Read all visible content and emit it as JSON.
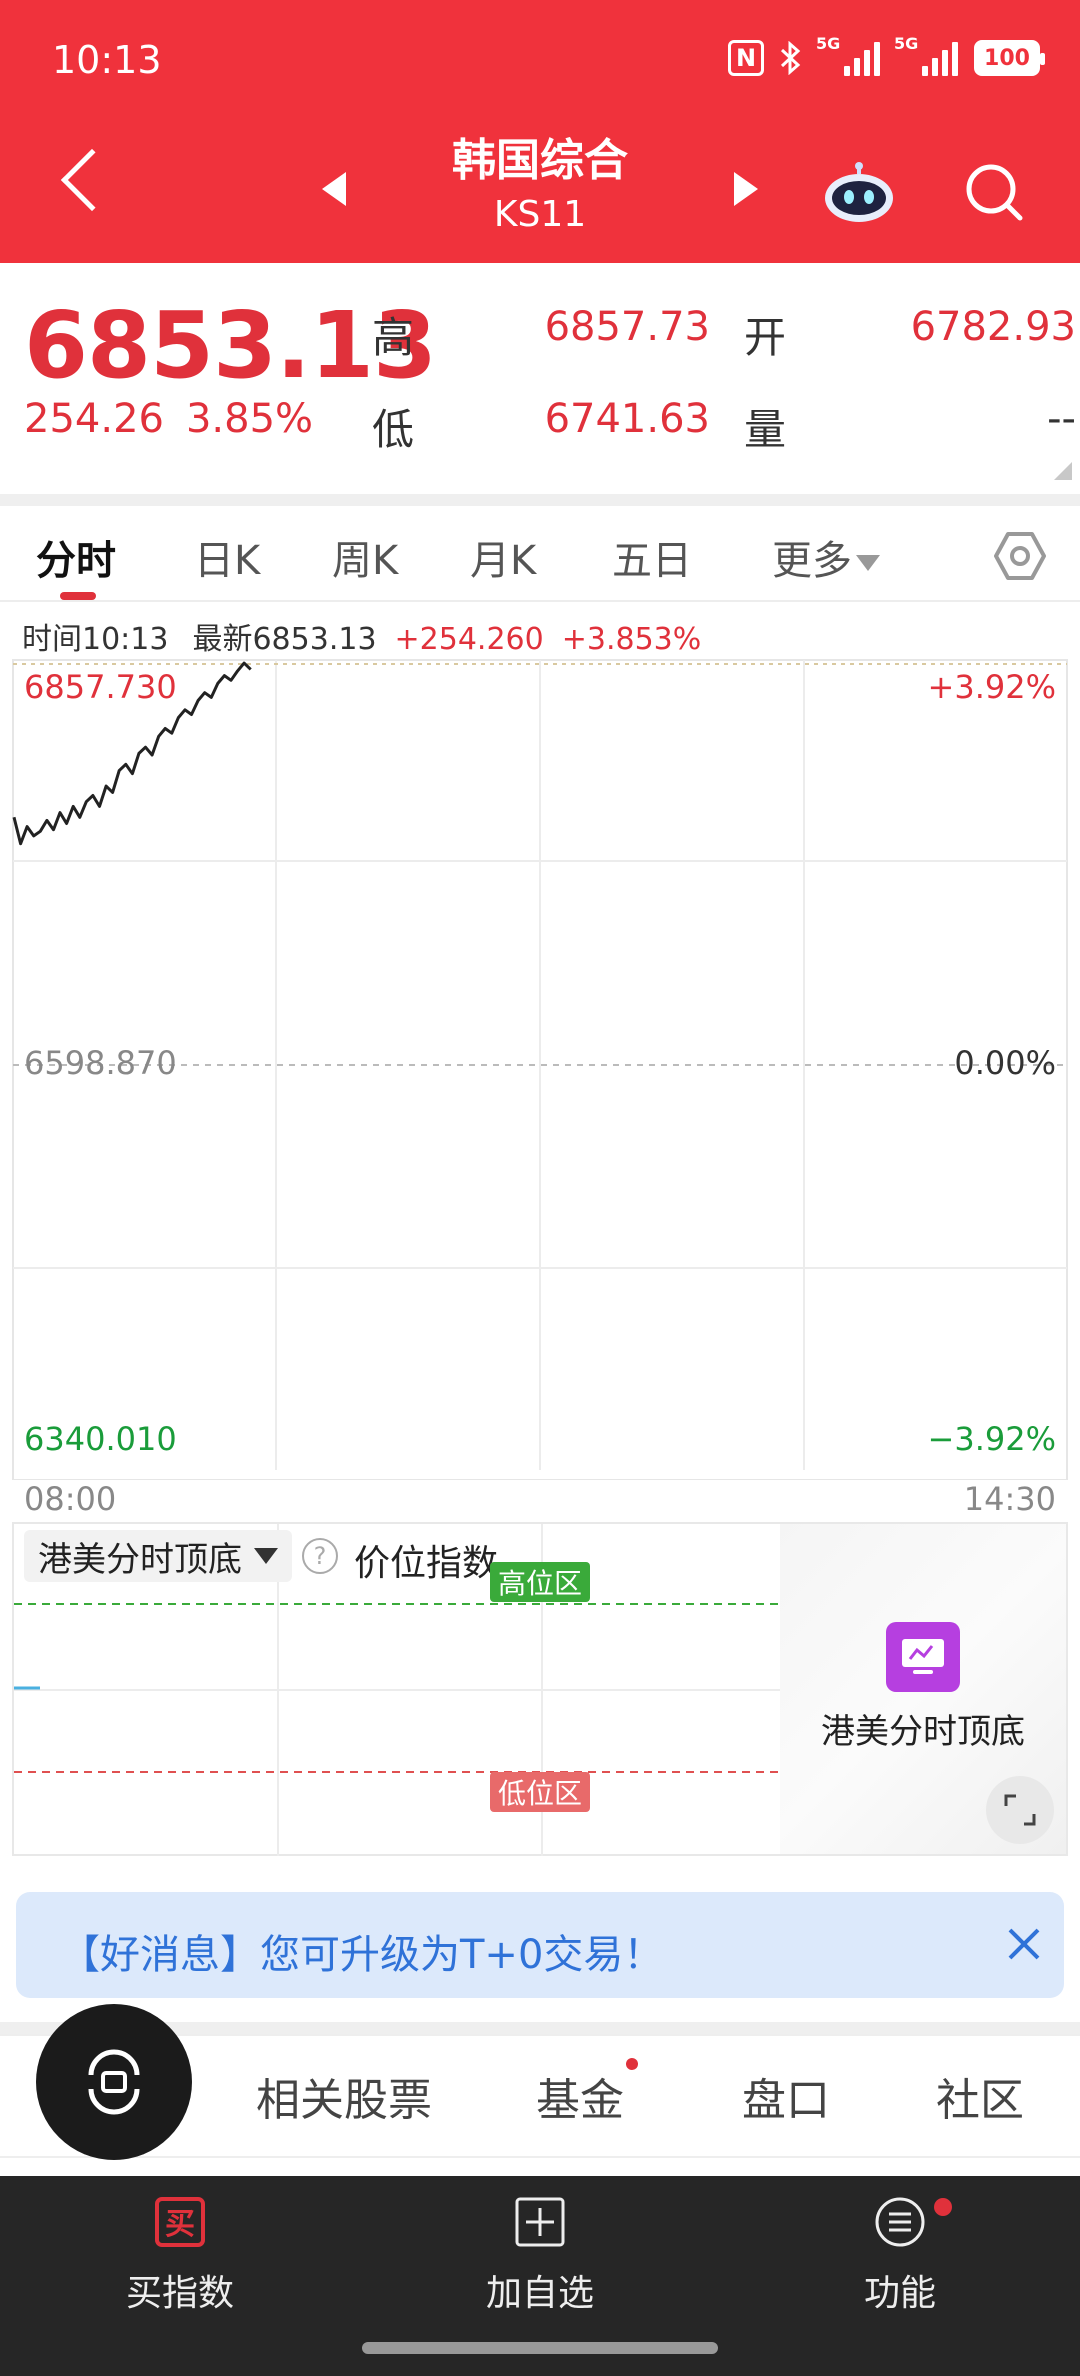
{
  "status_bar": {
    "time": "10:13",
    "signal_1_label": "5G",
    "signal_2_label": "5G",
    "battery": "100"
  },
  "header": {
    "title": "韩国综合",
    "code": "KS11"
  },
  "quote": {
    "price": "6853.13",
    "change": "254.26",
    "change_pct": "3.85%",
    "high_label": "高",
    "high": "6857.73",
    "low_label": "低",
    "low": "6741.63",
    "open_label": "开",
    "open": "6782.93",
    "volume_label": "量",
    "volume": "--"
  },
  "tabs": [
    {
      "label": "分时",
      "active": true
    },
    {
      "label": "日K"
    },
    {
      "label": "周K"
    },
    {
      "label": "月K"
    },
    {
      "label": "五日"
    },
    {
      "label": "更多"
    }
  ],
  "chart_info": {
    "time": "时间10:13",
    "latest": "最新6853.13",
    "change": "+254.260",
    "change_pct": "+3.853%"
  },
  "chart_data": {
    "type": "line",
    "ylim": [
      6340.01,
      6857.73
    ],
    "reference": 6598.87,
    "y_tick_labels": {
      "top": "6857.730",
      "mid": "6598.870",
      "bottom": "6340.010"
    },
    "pct_tick_labels": {
      "top": "+3.92%",
      "mid": "0.00%",
      "bottom": "−3.92%"
    },
    "x_tick_labels": {
      "start": "08:00",
      "end": "14:30"
    },
    "series": [
      {
        "values": [
          6758,
          6741,
          6752,
          6746,
          6749,
          6756,
          6750,
          6761,
          6754,
          6765,
          6758,
          6768,
          6772,
          6765,
          6778,
          6774,
          6788,
          6792,
          6786,
          6799,
          6803,
          6798,
          6810,
          6815,
          6812,
          6822,
          6827,
          6824,
          6833,
          6838,
          6835,
          6844,
          6849,
          6846,
          6852,
          6857,
          6853
        ]
      }
    ]
  },
  "indicator": {
    "selector_label": "港美分时顶底",
    "name": "价位指数--",
    "high_zone": "高位区",
    "low_zone": "低位区",
    "card_label": "港美分时顶底"
  },
  "banner": {
    "text": "【好消息】您可升级为T+0交易！"
  },
  "bottom_tabs": {
    "related_stocks": "相关股票",
    "fund": "基金",
    "order_book": "盘口",
    "community": "社区"
  },
  "actions": {
    "buy": "买指数",
    "add_watch": "加自选",
    "functions": "功能"
  },
  "colors": {
    "brand_red": "#f0323c",
    "up": "#e0313b",
    "down": "#1a9c3a",
    "link_blue": "#2f72d8"
  }
}
